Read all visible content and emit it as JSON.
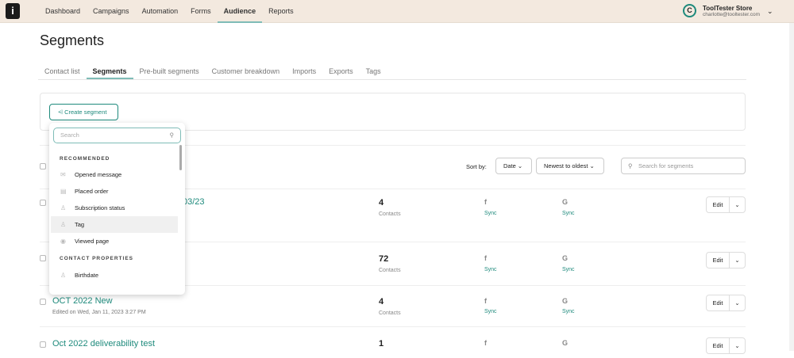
{
  "nav": {
    "logo": "i",
    "items": [
      "Dashboard",
      "Campaigns",
      "Automation",
      "Forms",
      "Audience",
      "Reports"
    ],
    "active": "Audience"
  },
  "account": {
    "initial": "C",
    "name": "ToolTester Store",
    "email": "charlotte@tooltester.com"
  },
  "page_title": "Segments",
  "tabs": [
    "Contact list",
    "Segments",
    "Pre-built segments",
    "Customer breakdown",
    "Imports",
    "Exports",
    "Tags"
  ],
  "create_segment": "Create segment",
  "dropdown": {
    "search_placeholder": "Search",
    "recommended": "RECOMMENDED",
    "rec_items": [
      "Opened message",
      "Placed order",
      "Subscription status",
      "Tag",
      "Viewed page"
    ],
    "contact_properties": "CONTACT PROPERTIES",
    "cp_items": [
      "Birthdate"
    ]
  },
  "sort": {
    "label": "Sort by:",
    "field": "Date",
    "order": "Newest to oldest"
  },
  "search_placeholder": "Search for segments",
  "rows": [
    {
      "title": "03/23",
      "subtitle": "",
      "count": "4"
    },
    {
      "title": "",
      "subtitle": "",
      "count": "72"
    },
    {
      "title": "OCT 2022 New",
      "subtitle": "Edited on Wed, Jan 11, 2023 3:27 PM",
      "count": "4"
    },
    {
      "title": "Oct 2022 deliverability test",
      "subtitle": "",
      "count": "1"
    }
  ],
  "contacts_label": "Contacts",
  "sync_label": "Sync",
  "edit_label": "Edit"
}
